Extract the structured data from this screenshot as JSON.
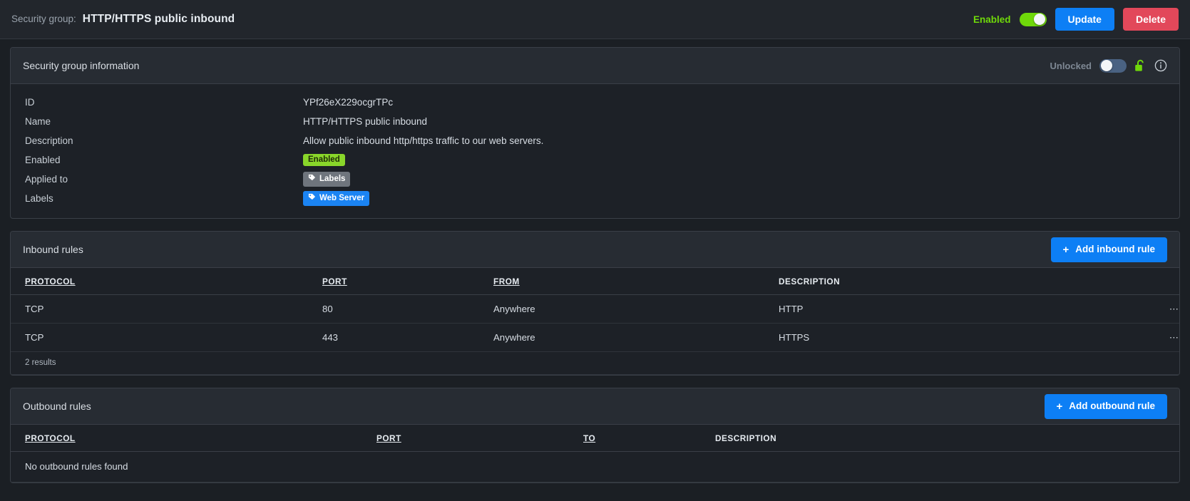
{
  "topbar": {
    "prefix_label": "Security group:",
    "group_name": "HTTP/HTTPS public inbound",
    "enabled_label": "Enabled",
    "update_label": "Update",
    "delete_label": "Delete",
    "toggle_state": "on",
    "enabled_color": "#6fd80a",
    "update_color": "#0d7ff5",
    "delete_color": "#e2485a"
  },
  "info_card": {
    "title": "Security group information",
    "lock_label": "Unlocked",
    "lock_toggle_state": "off",
    "lock_icon": "unlocked-padlock-icon",
    "info_icon": "info-circle-icon",
    "lock_icon_color": "#6fd80a",
    "rows": [
      {
        "key": "ID",
        "value": "YPf26eX229ocgrTPc",
        "type": "text"
      },
      {
        "key": "Name",
        "value": "HTTP/HTTPS public inbound",
        "type": "text"
      },
      {
        "key": "Description",
        "value": "Allow public inbound http/https traffic to our web servers.",
        "type": "text"
      },
      {
        "key": "Enabled",
        "value": "Enabled",
        "type": "badge-green"
      },
      {
        "key": "Applied to",
        "value": "Labels",
        "type": "badge-grey",
        "icon": "tag-icon"
      },
      {
        "key": "Labels",
        "value": "Web Server",
        "type": "badge-blue",
        "icon": "tag-icon"
      }
    ]
  },
  "inbound": {
    "title": "Inbound rules",
    "add_label": "Add inbound rule",
    "columns": [
      {
        "label": "PROTOCOL",
        "sortable": true
      },
      {
        "label": "PORT",
        "sortable": true
      },
      {
        "label": "FROM",
        "sortable": true
      },
      {
        "label": "DESCRIPTION",
        "sortable": false
      }
    ],
    "rows": [
      {
        "protocol": "TCP",
        "port": "80",
        "from": "Anywhere",
        "description": "HTTP",
        "menu": "⋯"
      },
      {
        "protocol": "TCP",
        "port": "443",
        "from": "Anywhere",
        "description": "HTTPS",
        "menu": "⋯"
      }
    ],
    "results_text": "2 results"
  },
  "outbound": {
    "title": "Outbound rules",
    "add_label": "Add outbound rule",
    "columns": [
      {
        "label": "PROTOCOL",
        "sortable": true
      },
      {
        "label": "PORT",
        "sortable": true
      },
      {
        "label": "TO",
        "sortable": true
      },
      {
        "label": "DESCRIPTION",
        "sortable": false
      }
    ],
    "empty_text": "No outbound rules found"
  }
}
